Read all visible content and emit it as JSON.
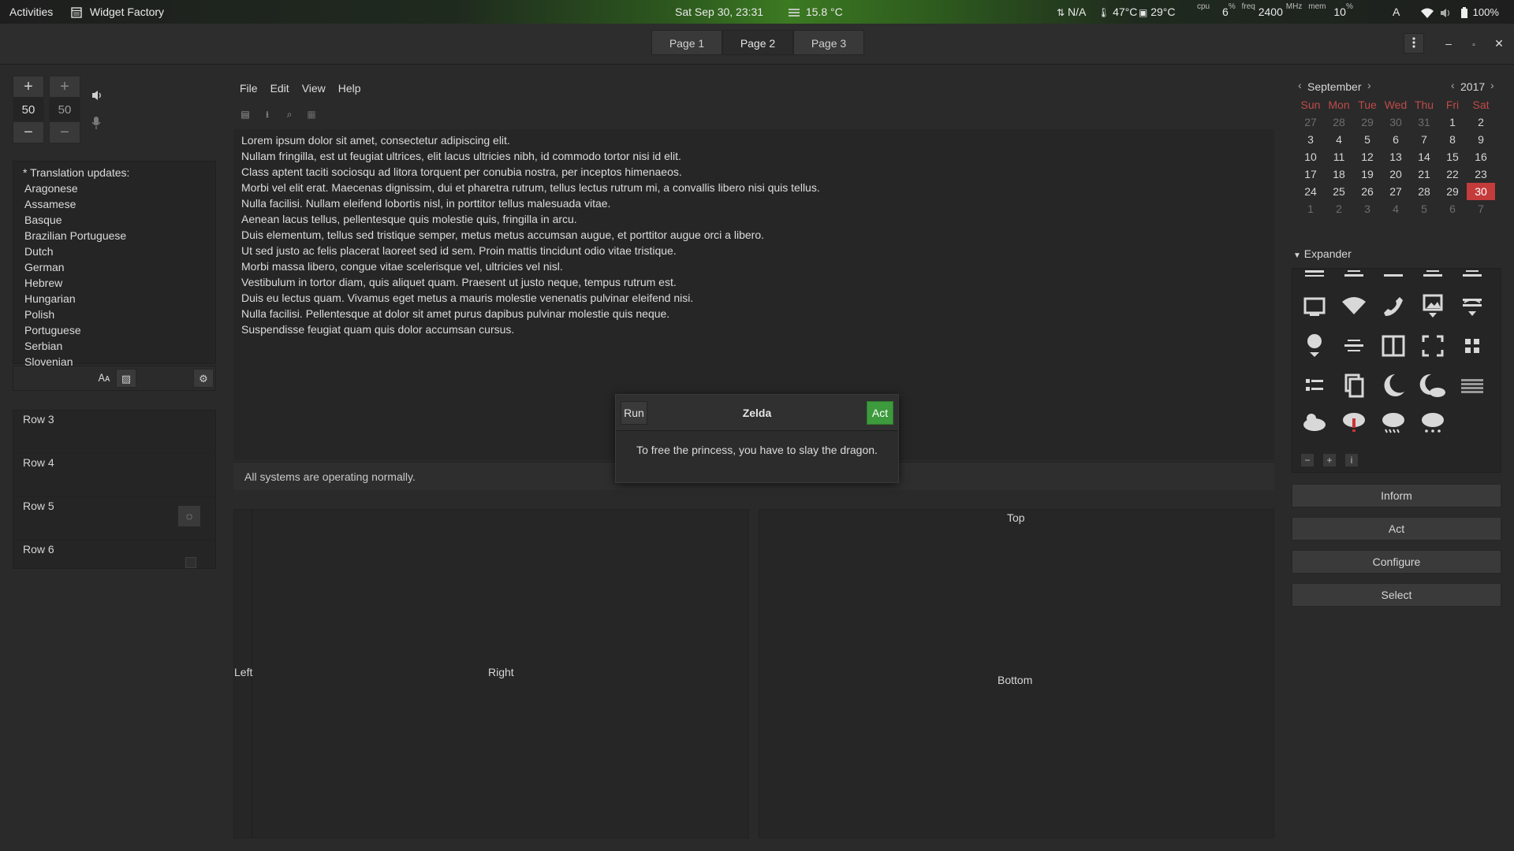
{
  "topbar": {
    "activities": "Activities",
    "app_name": "Widget Factory",
    "datetime": "Sat Sep 30, 23:31",
    "weather": "15.8 °C",
    "vpn": "N/A",
    "temp1": "47°C",
    "temp2": "29°C",
    "cpu_label": "cpu",
    "cpu_val": "6",
    "cpu_unit": "%",
    "freq_label": "freq",
    "freq_val": "2400",
    "freq_unit": "MHz",
    "mem_label": "mem",
    "mem_val": "10",
    "mem_unit": "%",
    "keyboard": "A",
    "battery": "100%"
  },
  "header": {
    "tabs": [
      {
        "label": "Page 1"
      },
      {
        "label": "Page 2"
      },
      {
        "label": "Page 3"
      }
    ],
    "active_tab": 1
  },
  "spinners": {
    "left_value": "50",
    "right_value": "50",
    "plus": "+",
    "minus": "−"
  },
  "languages": {
    "header": "* Translation updates:",
    "items": [
      "Aragonese",
      "Assamese",
      "Basque",
      "Brazilian Portuguese",
      "Dutch",
      "German",
      "Hebrew",
      "Hungarian",
      "Polish",
      "Portuguese",
      "Serbian",
      "Slovenian"
    ]
  },
  "rows": [
    {
      "label": "Row 3"
    },
    {
      "label": "Row 4"
    },
    {
      "label": "Row 5"
    },
    {
      "label": "Row 6"
    }
  ],
  "menu": {
    "file": "File",
    "edit": "Edit",
    "view": "View",
    "help": "Help"
  },
  "text_lines": [
    "Lorem ipsum dolor sit amet, consectetur adipiscing elit.",
    "Nullam fringilla, est ut feugiat ultrices, elit lacus ultricies nibh, id commodo tortor nisi id elit.",
    "Class aptent taciti sociosqu ad litora torquent per conubia nostra, per inceptos himenaeos.",
    "Morbi vel elit erat. Maecenas dignissim, dui et pharetra rutrum, tellus lectus rutrum mi, a convallis libero nisi quis tellus.",
    "Nulla facilisi. Nullam eleifend lobortis nisl, in porttitor tellus malesuada vitae.",
    "Aenean lacus tellus, pellentesque quis molestie quis, fringilla in arcu.",
    "Duis elementum, tellus sed tristique semper, metus metus accumsan augue, et porttitor augue orci a libero.",
    "Ut sed justo ac felis placerat laoreet sed id sem. Proin mattis tincidunt odio vitae tristique.",
    "Morbi massa libero, congue vitae scelerisque vel, ultricies vel nisl.",
    "Vestibulum in tortor diam, quis aliquet quam. Praesent ut justo neque, tempus rutrum est.",
    "Duis eu lectus quam. Vivamus eget metus a mauris molestie venenatis pulvinar eleifend nisi.",
    "Nulla facilisi. Pellentesque at dolor sit amet purus dapibus pulvinar molestie quis neque.",
    "Suspendisse feugiat quam quis dolor accumsan cursus."
  ],
  "status": "All systems are operating normally.",
  "panes": {
    "left": "Left",
    "right": "Right",
    "top": "Top",
    "bottom": "Bottom"
  },
  "dialog": {
    "run": "Run",
    "title": "Zelda",
    "act": "Act",
    "message": "To free the princess, you have to slay the dragon."
  },
  "calendar": {
    "month": "September",
    "year": "2017",
    "weekdays": [
      "Sun",
      "Mon",
      "Tue",
      "Wed",
      "Thu",
      "Fri",
      "Sat"
    ],
    "days": [
      "27",
      "28",
      "29",
      "30",
      "31",
      "1",
      "2",
      "3",
      "4",
      "5",
      "6",
      "7",
      "8",
      "9",
      "10",
      "11",
      "12",
      "13",
      "14",
      "15",
      "16",
      "17",
      "18",
      "19",
      "20",
      "21",
      "22",
      "23",
      "24",
      "25",
      "26",
      "27",
      "28",
      "29",
      "30",
      "1",
      "2",
      "3",
      "4",
      "5",
      "6",
      "7"
    ],
    "selected_day": "30"
  },
  "expander": {
    "label": "Expander"
  },
  "buttons": {
    "inform": "Inform",
    "act": "Act",
    "configure": "Configure",
    "select": "Select"
  },
  "colors": {
    "accent": "#3d9a3d",
    "selected_day": "#c43b3b",
    "weekday_header": "#c04a4a"
  }
}
